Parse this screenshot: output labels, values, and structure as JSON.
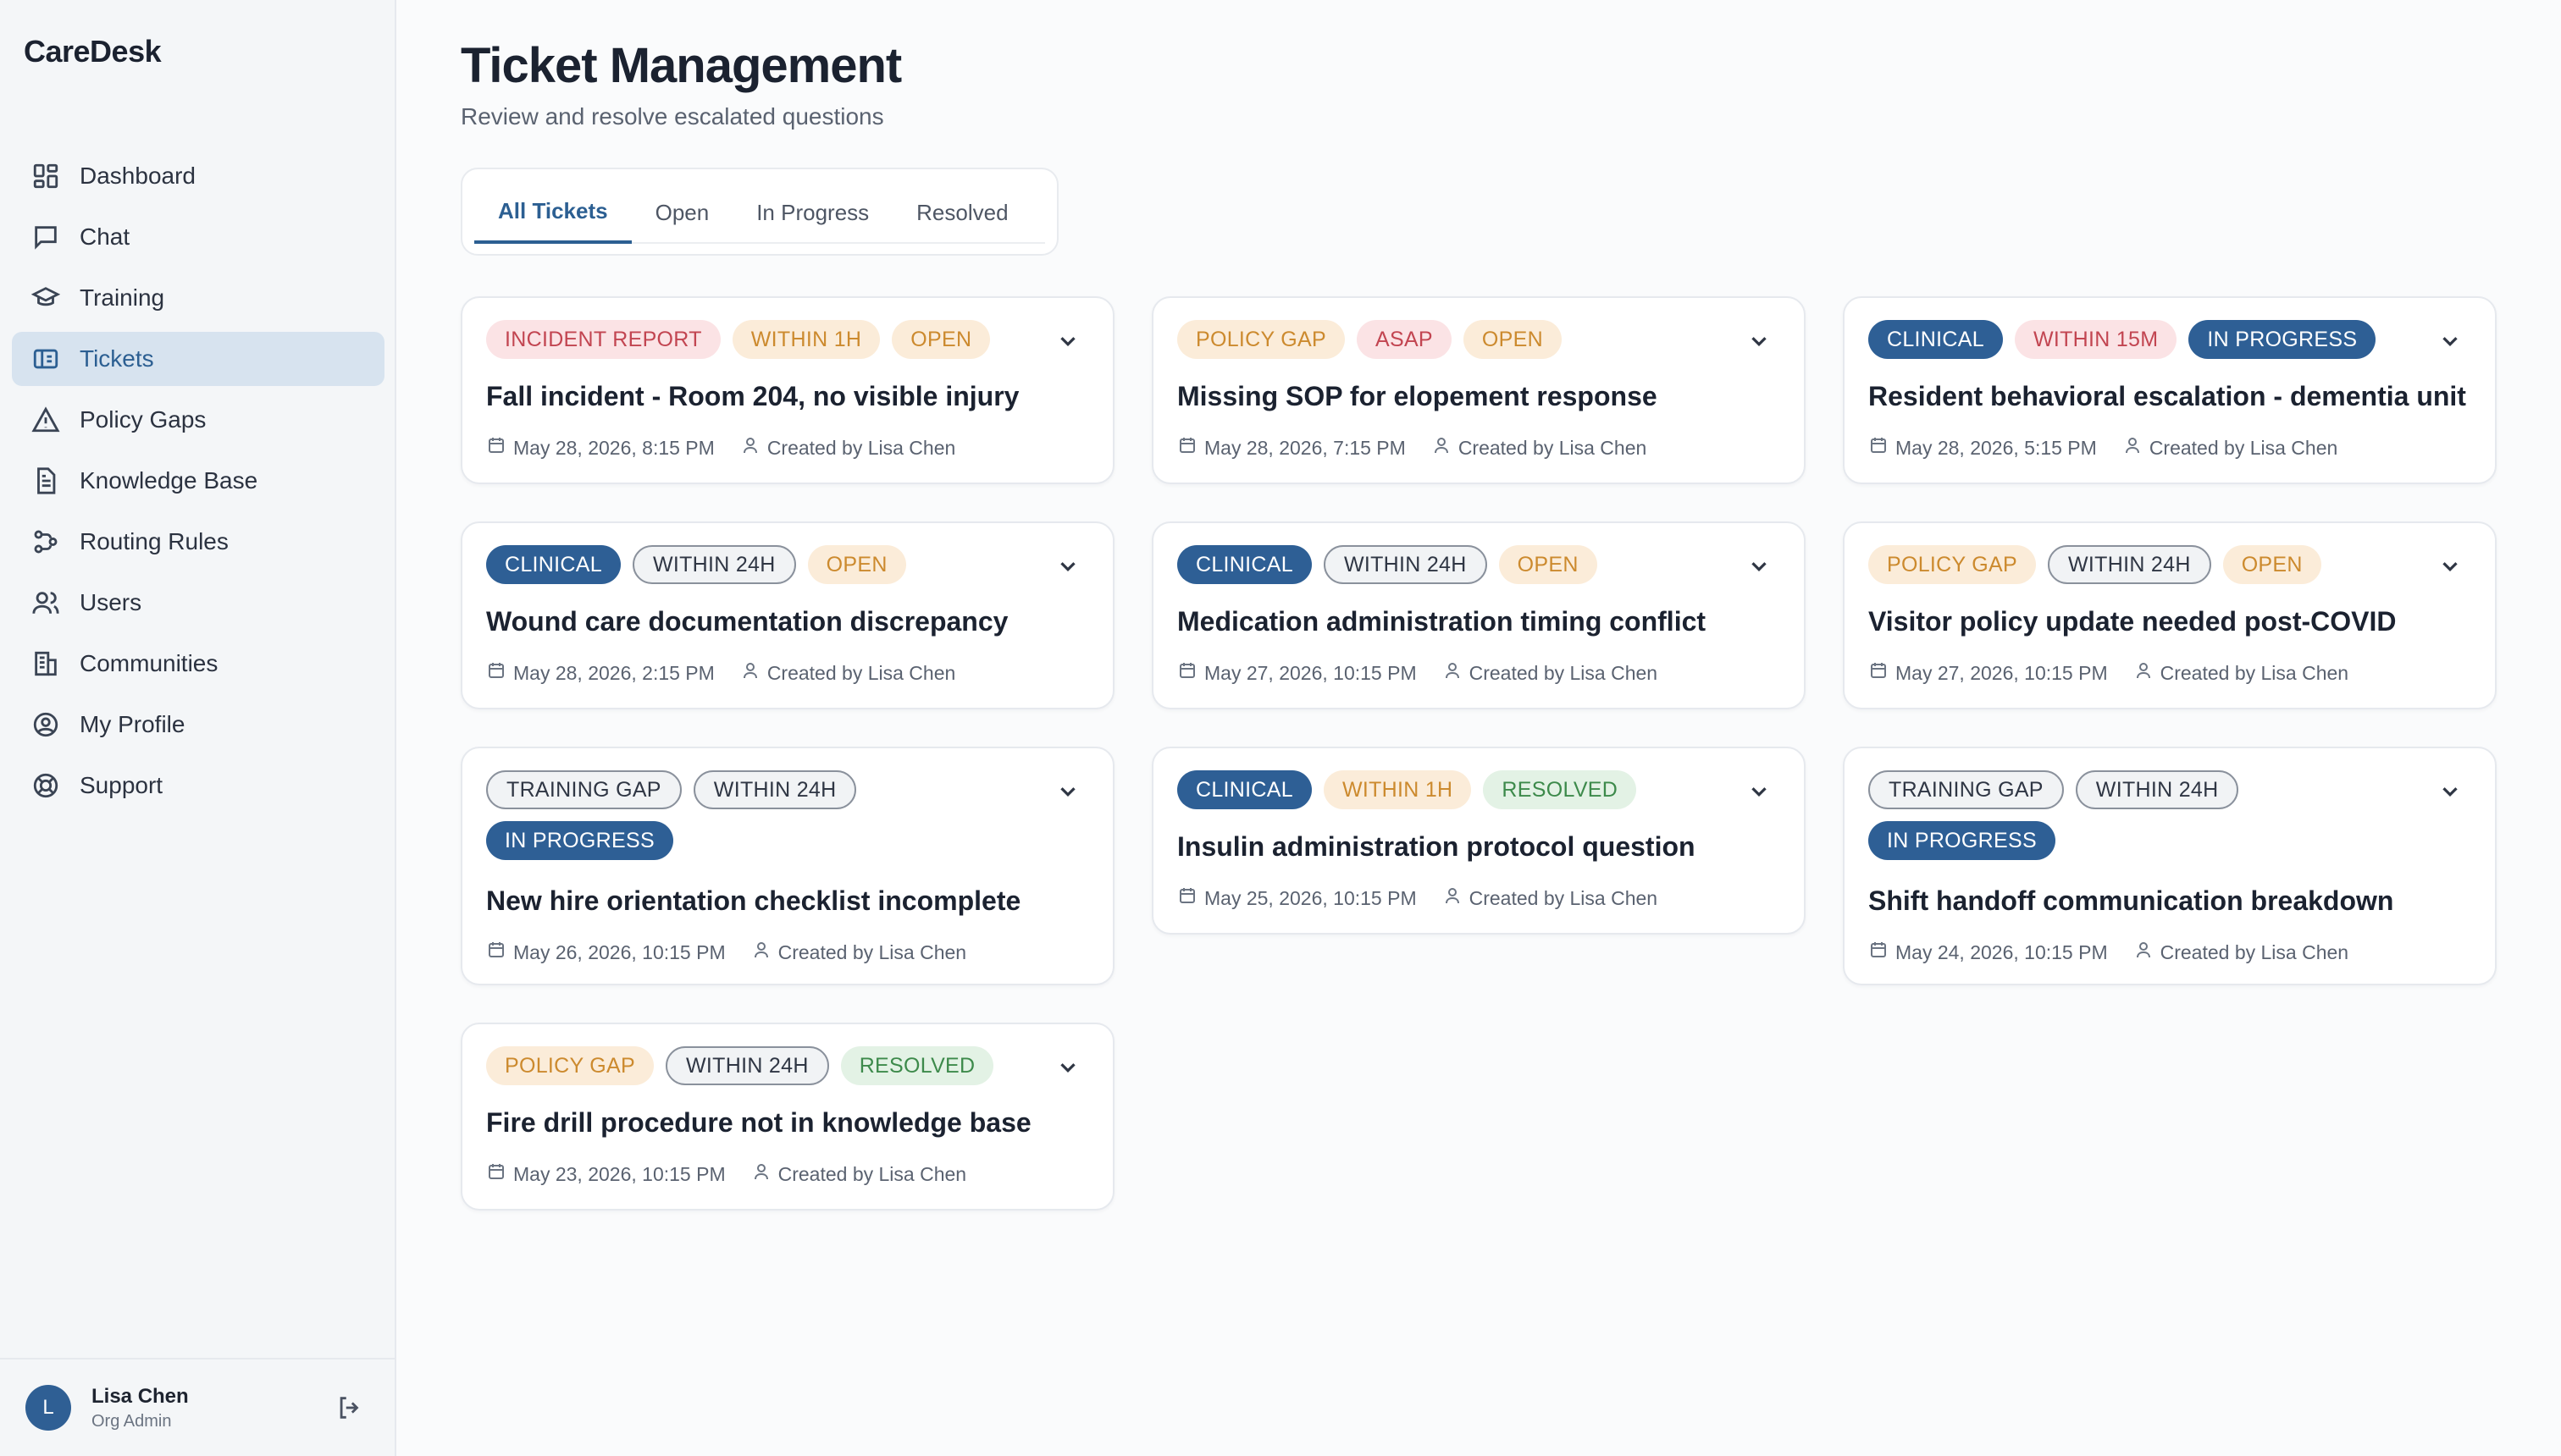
{
  "app": {
    "name": "CareDesk"
  },
  "sidebar": {
    "items": [
      {
        "label": "Dashboard",
        "icon": "dashboard-icon",
        "active": false
      },
      {
        "label": "Chat",
        "icon": "chat-icon",
        "active": false
      },
      {
        "label": "Training",
        "icon": "graduation-cap-icon",
        "active": false
      },
      {
        "label": "Tickets",
        "icon": "ticket-icon",
        "active": true
      },
      {
        "label": "Policy Gaps",
        "icon": "warning-triangle-icon",
        "active": false
      },
      {
        "label": "Knowledge Base",
        "icon": "document-icon",
        "active": false
      },
      {
        "label": "Routing Rules",
        "icon": "routing-icon",
        "active": false
      },
      {
        "label": "Users",
        "icon": "users-icon",
        "active": false
      },
      {
        "label": "Communities",
        "icon": "building-icon",
        "active": false
      },
      {
        "label": "My Profile",
        "icon": "user-circle-icon",
        "active": false
      },
      {
        "label": "Support",
        "icon": "lifebuoy-icon",
        "active": false
      }
    ],
    "user": {
      "initial": "L",
      "name": "Lisa Chen",
      "role": "Org Admin"
    }
  },
  "header": {
    "title": "Ticket Management",
    "subtitle": "Review and resolve escalated questions"
  },
  "tabs": [
    {
      "label": "All Tickets",
      "active": true
    },
    {
      "label": "Open",
      "active": false
    },
    {
      "label": "In Progress",
      "active": false
    },
    {
      "label": "Resolved",
      "active": false
    }
  ],
  "tickets": [
    {
      "badges": [
        {
          "text": "INCIDENT REPORT",
          "style": "red"
        },
        {
          "text": "WITHIN 1H",
          "style": "orange"
        },
        {
          "text": "OPEN",
          "style": "orange"
        }
      ],
      "title": "Fall incident - Room 204, no visible injury",
      "date": "May 28, 2026, 8:15 PM",
      "creator": "Created by Lisa Chen"
    },
    {
      "badges": [
        {
          "text": "POLICY GAP",
          "style": "orange"
        },
        {
          "text": "ASAP",
          "style": "red"
        },
        {
          "text": "OPEN",
          "style": "orange"
        }
      ],
      "title": "Missing SOP for elopement response",
      "date": "May 28, 2026, 7:15 PM",
      "creator": "Created by Lisa Chen"
    },
    {
      "badges": [
        {
          "text": "CLINICAL",
          "style": "blue"
        },
        {
          "text": "WITHIN 15M",
          "style": "red"
        },
        {
          "text": "IN PROGRESS",
          "style": "blue"
        }
      ],
      "title": "Resident behavioral escalation - dementia unit",
      "date": "May 28, 2026, 5:15 PM",
      "creator": "Created by Lisa Chen"
    },
    {
      "badges": [
        {
          "text": "CLINICAL",
          "style": "blue"
        },
        {
          "text": "WITHIN 24H",
          "style": "gray"
        },
        {
          "text": "OPEN",
          "style": "orange"
        }
      ],
      "title": "Wound care documentation discrepancy",
      "date": "May 28, 2026, 2:15 PM",
      "creator": "Created by Lisa Chen"
    },
    {
      "badges": [
        {
          "text": "CLINICAL",
          "style": "blue"
        },
        {
          "text": "WITHIN 24H",
          "style": "gray"
        },
        {
          "text": "OPEN",
          "style": "orange"
        }
      ],
      "title": "Medication administration timing conflict",
      "date": "May 27, 2026, 10:15 PM",
      "creator": "Created by Lisa Chen"
    },
    {
      "badges": [
        {
          "text": "POLICY GAP",
          "style": "orange"
        },
        {
          "text": "WITHIN 24H",
          "style": "gray"
        },
        {
          "text": "OPEN",
          "style": "orange"
        }
      ],
      "title": "Visitor policy update needed post-COVID",
      "date": "May 27, 2026, 10:15 PM",
      "creator": "Created by Lisa Chen"
    },
    {
      "badges": [
        {
          "text": "TRAINING GAP",
          "style": "gray"
        },
        {
          "text": "WITHIN 24H",
          "style": "gray"
        },
        {
          "text": "IN PROGRESS",
          "style": "blue"
        }
      ],
      "title": "New hire orientation checklist incomplete",
      "date": "May 26, 2026, 10:15 PM",
      "creator": "Created by Lisa Chen"
    },
    {
      "badges": [
        {
          "text": "CLINICAL",
          "style": "blue"
        },
        {
          "text": "WITHIN 1H",
          "style": "orange"
        },
        {
          "text": "RESOLVED",
          "style": "green"
        }
      ],
      "title": "Insulin administration protocol question",
      "date": "May 25, 2026, 10:15 PM",
      "creator": "Created by Lisa Chen"
    },
    {
      "badges": [
        {
          "text": "TRAINING GAP",
          "style": "gray"
        },
        {
          "text": "WITHIN 24H",
          "style": "gray"
        },
        {
          "text": "IN PROGRESS",
          "style": "blue"
        }
      ],
      "title": "Shift handoff communication breakdown",
      "date": "May 24, 2026, 10:15 PM",
      "creator": "Created by Lisa Chen"
    },
    {
      "badges": [
        {
          "text": "POLICY GAP",
          "style": "orange"
        },
        {
          "text": "WITHIN 24H",
          "style": "gray"
        },
        {
          "text": "RESOLVED",
          "style": "green"
        }
      ],
      "title": "Fire drill procedure not in knowledge base",
      "date": "May 23, 2026, 10:15 PM",
      "creator": "Created by Lisa Chen"
    }
  ],
  "colors": {
    "accent": "#2c5f92",
    "active_nav_bg": "#d7e3ef"
  }
}
